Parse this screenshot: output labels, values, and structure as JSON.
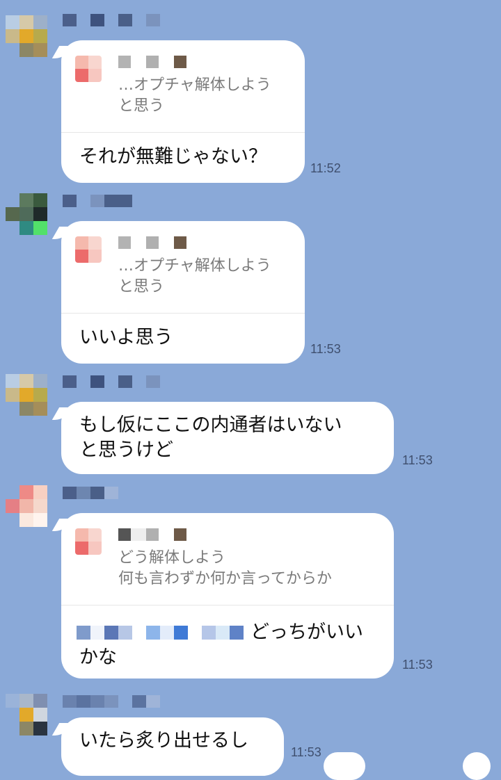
{
  "colors": {
    "background": "#8aa9d8",
    "bubble": "#ffffff",
    "time_text": "#3f4f6e",
    "quote_text": "#7a7a7a"
  },
  "messages": [
    {
      "reply_quote": "…オプチャ解体しよう\nと思う",
      "text": "それが無難じゃない？",
      "time": "11:52"
    },
    {
      "reply_quote": "…オプチャ解体しよう\nと思う",
      "text": "いいよ思う",
      "time": "11:53"
    },
    {
      "text": "もし仮にここの内通者はいない\nと思うけど",
      "time": "11:53"
    },
    {
      "reply_quote": "どう解体しよう\n何も言わずか何か言ってからか",
      "text": "どっちがいい\nかな",
      "time": "11:53"
    },
    {
      "text": "いたら炙り出せるし",
      "time": "11:53"
    }
  ]
}
